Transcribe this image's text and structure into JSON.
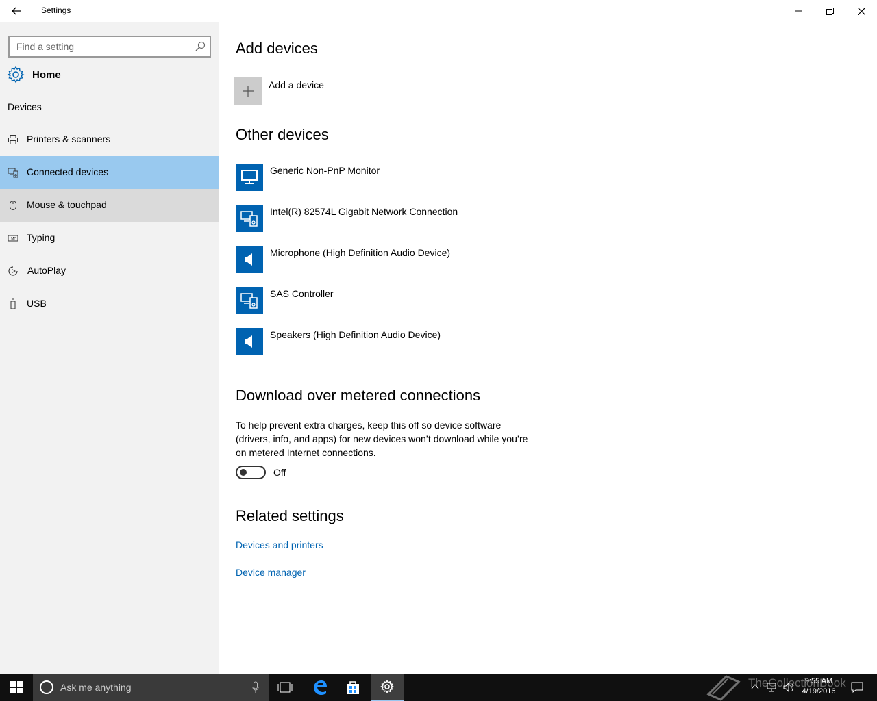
{
  "window": {
    "title": "Settings"
  },
  "sidebar": {
    "search_placeholder": "Find a setting",
    "home_label": "Home",
    "section_label": "Devices",
    "items": [
      {
        "label": "Printers & scanners",
        "icon": "printer-icon"
      },
      {
        "label": "Connected devices",
        "icon": "connected-devices-icon",
        "state": "selected"
      },
      {
        "label": "Mouse & touchpad",
        "icon": "mouse-icon",
        "state": "hover"
      },
      {
        "label": "Typing",
        "icon": "keyboard-icon"
      },
      {
        "label": "AutoPlay",
        "icon": "autoplay-icon"
      },
      {
        "label": "USB",
        "icon": "usb-icon"
      }
    ]
  },
  "main": {
    "add_devices": {
      "heading": "Add devices",
      "add_label": "Add a device"
    },
    "other_devices": {
      "heading": "Other devices",
      "devices": [
        {
          "name": "Generic Non-PnP Monitor",
          "icon": "monitor-icon"
        },
        {
          "name": "Intel(R) 82574L Gigabit Network Connection",
          "icon": "devices-icon"
        },
        {
          "name": "Microphone (High Definition Audio Device)",
          "icon": "speaker-icon"
        },
        {
          "name": "SAS Controller",
          "icon": "devices-icon"
        },
        {
          "name": "Speakers (High Definition Audio Device)",
          "icon": "speaker-icon"
        }
      ]
    },
    "metered": {
      "heading": "Download over metered connections",
      "description": "To help prevent extra charges, keep this off so device software (drivers, info, and apps) for new devices won’t download while you’re on metered Internet connections.",
      "toggle_state": "Off"
    },
    "related": {
      "heading": "Related settings",
      "links": [
        "Devices and printers",
        "Device manager"
      ]
    }
  },
  "taskbar": {
    "search_placeholder": "Ask me anything",
    "time": "9:55 AM",
    "date": "4/19/2016",
    "watermark": "TheCollectionBook"
  },
  "colors": {
    "accent": "#0063b1",
    "selected_bg": "#99c9ef",
    "sidebar_bg": "#f2f2f2"
  }
}
